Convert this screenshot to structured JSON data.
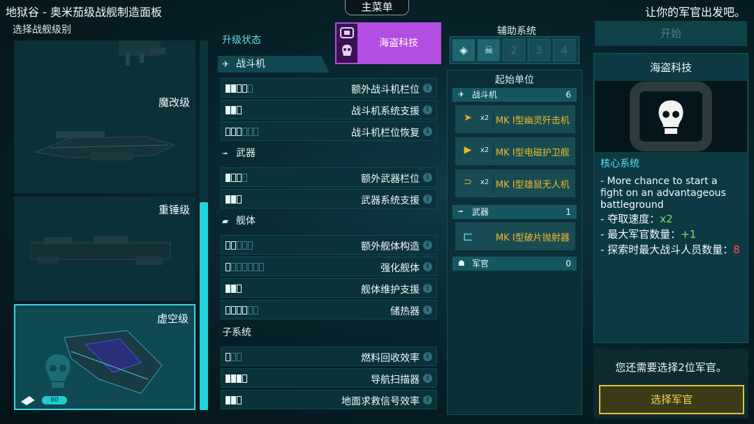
{
  "header": {
    "title": "地狱谷 - 奥米茄级战舰制造面板",
    "menu_label": "主菜单",
    "officer_prompt": "让你的军官出发吧。"
  },
  "ship_select": {
    "title": "选择战舰级别",
    "ships": [
      {
        "label": "魔改级"
      },
      {
        "label": "重锤级"
      },
      {
        "label": "虚空级",
        "selected": true,
        "badge_value": "80"
      }
    ]
  },
  "upgrades": {
    "title": "升级状态",
    "sections": [
      {
        "title": "战斗机",
        "icon": "fighter-icon",
        "rows": [
          {
            "label": "额外战斗机栏位",
            "pips": [
              1,
              1,
              0,
              0,
              -1
            ]
          },
          {
            "label": "战斗机系统支援",
            "pips": [
              1,
              1,
              0
            ]
          },
          {
            "label": "战斗机栏位恢复",
            "pips": [
              0,
              0,
              0,
              -1,
              -1,
              -1
            ]
          }
        ]
      },
      {
        "title": "武器",
        "icon": "weapon-icon",
        "rows": [
          {
            "label": "额外武器栏位",
            "pips": [
              1,
              0,
              0,
              -1
            ]
          },
          {
            "label": "武器系统支援",
            "pips": [
              1,
              1,
              0
            ]
          }
        ]
      },
      {
        "title": "舰体",
        "icon": "hull-icon",
        "rows": [
          {
            "label": "额外舰体构造",
            "pips": [
              0,
              0,
              -1,
              -1,
              -1
            ]
          },
          {
            "label": "强化舰体",
            "pips": [
              0,
              -1,
              -1,
              -1,
              -1,
              -1,
              -1
            ]
          },
          {
            "label": "舰体维护支援",
            "pips": [
              1,
              1,
              0
            ]
          },
          {
            "label": "储热器",
            "pips": [
              0,
              0,
              0,
              0,
              -1,
              -1
            ]
          }
        ]
      },
      {
        "title": "子系统",
        "icon": "",
        "rows": [
          {
            "label": "燃料回收效率",
            "pips": [
              0,
              -1,
              -1
            ]
          },
          {
            "label": "导航扫描器",
            "pips": [
              1,
              1,
              1,
              0
            ]
          },
          {
            "label": "地面求救信号效率",
            "pips": [
              1,
              1,
              0
            ]
          }
        ]
      }
    ]
  },
  "faction": {
    "label": "海盗科技",
    "color": "#b34ee2"
  },
  "aux_systems": {
    "title": "辅助系统",
    "slots": [
      "",
      "",
      "2",
      "3",
      "4"
    ]
  },
  "start_units": {
    "title": "起始单位",
    "groups": [
      {
        "title": "战斗机",
        "count": "6",
        "icon": "fighter-icon",
        "items": [
          {
            "mult": "x2",
            "name": "MK I型幽灵歼击机"
          },
          {
            "mult": "x2",
            "name": "MK I型电磁护卫舰"
          },
          {
            "mult": "x2",
            "name": "MK I型雄鼠无人机"
          }
        ]
      },
      {
        "title": "武器",
        "count": "1",
        "icon": "weapon-icon",
        "items": [
          {
            "mult": "",
            "name": "MK I型破片抛射器"
          }
        ]
      },
      {
        "title": "军官",
        "count": "0",
        "icon": "officer-icon",
        "items": []
      }
    ]
  },
  "right_panel": {
    "start_label": "开始",
    "title": "海盗科技",
    "core_label": "核心系统",
    "desc_intro": "- More chance to start a fight on an advantageous battleground",
    "stats": [
      {
        "label": "- 夺取速度：",
        "value": "x2",
        "tone": "green"
      },
      {
        "label": "- 最大军官数量：",
        "value": "+1",
        "tone": "green"
      },
      {
        "label": "- 探索时最大战斗人员数量：",
        "value": "8",
        "tone": "red"
      }
    ],
    "need_text": "您还需要选择2位军官。",
    "select_officer_label": "选择军官"
  }
}
